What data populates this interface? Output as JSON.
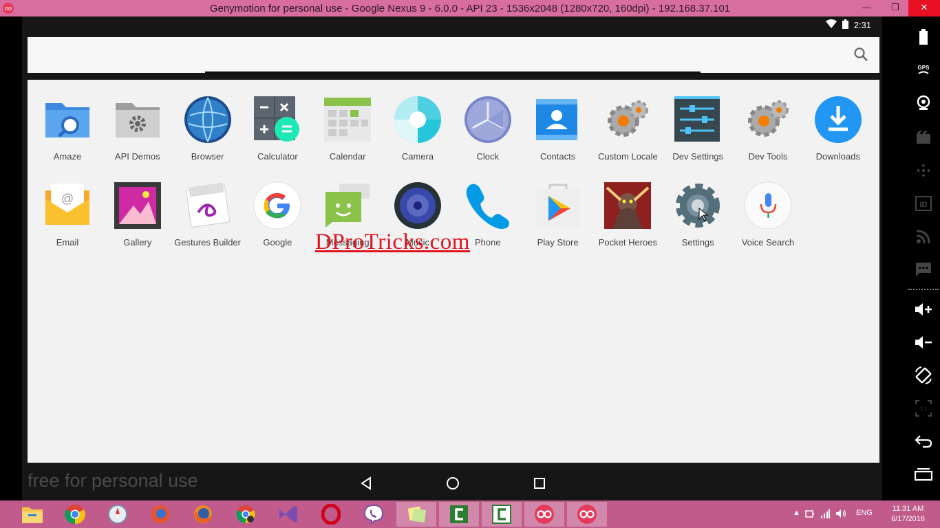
{
  "window": {
    "title": "Genymotion for personal use - Google Nexus 9 - 6.0.0 - API 23 - 1536x2048 (1280x720, 160dpi) - 192.168.37.101",
    "app_icon_text": "oo",
    "minimize": "—",
    "restore": "❐",
    "close": "✕"
  },
  "statusbar": {
    "time": "2:31",
    "wifi_icon": "wifi-icon",
    "battery_icon": "battery-icon"
  },
  "apps": [
    {
      "label": "Amaze",
      "icon": "amaze-icon"
    },
    {
      "label": "API Demos",
      "icon": "api-demos-icon"
    },
    {
      "label": "Browser",
      "icon": "browser-icon"
    },
    {
      "label": "Calculator",
      "icon": "calculator-icon"
    },
    {
      "label": "Calendar",
      "icon": "calendar-icon"
    },
    {
      "label": "Camera",
      "icon": "camera-icon"
    },
    {
      "label": "Clock",
      "icon": "clock-icon"
    },
    {
      "label": "Contacts",
      "icon": "contacts-icon"
    },
    {
      "label": "Custom Locale",
      "icon": "custom-locale-icon"
    },
    {
      "label": "Dev Settings",
      "icon": "dev-settings-icon"
    },
    {
      "label": "Dev Tools",
      "icon": "dev-tools-icon"
    },
    {
      "label": "Downloads",
      "icon": "downloads-icon"
    },
    {
      "label": "Email",
      "icon": "email-icon"
    },
    {
      "label": "Gallery",
      "icon": "gallery-icon"
    },
    {
      "label": "Gestures Builder",
      "icon": "gestures-builder-icon"
    },
    {
      "label": "Google",
      "icon": "google-icon"
    },
    {
      "label": "Messaging",
      "icon": "messaging-icon"
    },
    {
      "label": "Music",
      "icon": "music-icon"
    },
    {
      "label": "Phone",
      "icon": "phone-icon"
    },
    {
      "label": "Play Store",
      "icon": "play-store-icon"
    },
    {
      "label": "Pocket Heroes",
      "icon": "pocket-heroes-icon"
    },
    {
      "label": "Settings",
      "icon": "settings-icon"
    },
    {
      "label": "Voice Search",
      "icon": "voice-search-icon"
    }
  ],
  "watermark": "DProTricks.com",
  "footer_text": "free for personal use",
  "taskbar": {
    "tray_lang": "ENG",
    "time": "11:31 AM",
    "date": "6/17/2016"
  },
  "colors": {
    "titlebar": "#d86ea0",
    "taskbar": "#c15b8b",
    "watermark": "#e0141e",
    "drawer_bg": "#f2f2f2"
  }
}
